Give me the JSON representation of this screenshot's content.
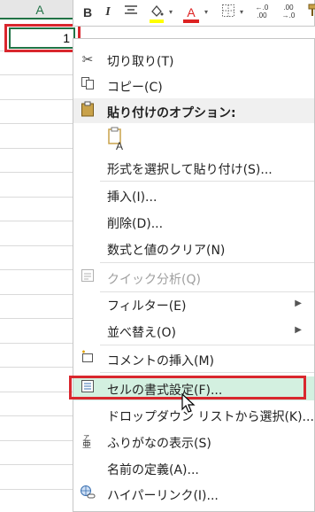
{
  "sheet": {
    "column_letter": "A",
    "cell_value": "1"
  },
  "mini_toolbar": {
    "bold": "B",
    "italic": "I",
    "align_icon": "align-center-icon",
    "fill_icon": "fill-color-icon",
    "font_color_label": "A",
    "border_icon": "borders-icon",
    "increase_decimal": "←.0\n.00",
    "decrease_decimal": ".00\n→.0",
    "format_painter_icon": "format-painter-icon",
    "fill_color": "#ffff00",
    "font_color": "#dd2222"
  },
  "context_menu": {
    "items": [
      {
        "label": "切り取り(T)",
        "icon": "scissors-icon"
      },
      {
        "label": "コピー(C)",
        "icon": "copy-icon"
      },
      {
        "label": "貼り付けのオプション:",
        "icon": "clipboard-icon",
        "type": "header"
      },
      {
        "label": "形式を選択して貼り付け(S)..."
      },
      {
        "label": "挿入(I)..."
      },
      {
        "label": "削除(D)..."
      },
      {
        "label": "数式と値のクリア(N)"
      },
      {
        "label": "クイック分析(Q)",
        "icon": "quick-analysis-icon",
        "disabled": true
      },
      {
        "label": "フィルター(E)",
        "submenu": true
      },
      {
        "label": "並べ替え(O)",
        "submenu": true
      },
      {
        "label": "コメントの挿入(M)",
        "icon": "comment-icon"
      },
      {
        "label": "セルの書式設定(F)...",
        "icon": "format-cells-icon",
        "hovered": true
      },
      {
        "label": "ドロップダウン リストから選択(K)..."
      },
      {
        "label": "ふりがなの表示(S)",
        "icon": "furigana-icon"
      },
      {
        "label": "名前の定義(A)..."
      },
      {
        "label": "ハイパーリンク(I)...",
        "icon": "hyperlink-icon"
      }
    ],
    "paste_option_icon": "paste-keep-text-icon",
    "highlight_color": "#d9272e",
    "hover_color": "#d3f0e0"
  }
}
